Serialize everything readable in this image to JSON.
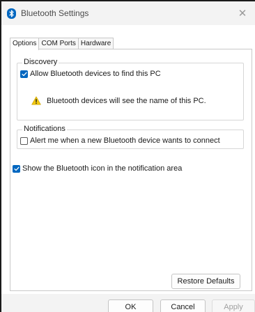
{
  "window": {
    "title": "Bluetooth Settings",
    "close_glyph": "✕",
    "icon": "bluetooth-icon"
  },
  "tabs": [
    {
      "label": "Options",
      "active": true
    },
    {
      "label": "COM Ports",
      "active": false
    },
    {
      "label": "Hardware",
      "active": false
    }
  ],
  "discovery": {
    "label": "Discovery",
    "allow_label": "Allow Bluetooth devices to find this PC",
    "allow_checked": true,
    "warning_text": "Bluetooth devices will see the name of this PC.",
    "warning_icon": "warning-icon"
  },
  "notifications": {
    "label": "Notifications",
    "alert_label": "Alert me when a new Bluetooth device wants to connect",
    "alert_checked": false
  },
  "show_icon": {
    "label": "Show the Bluetooth icon in the notification area",
    "checked": true
  },
  "buttons": {
    "restore": "Restore Defaults",
    "ok": "OK",
    "cancel": "Cancel",
    "apply": "Apply"
  },
  "colors": {
    "accent": "#0067c0",
    "warning": "#f2c811"
  }
}
